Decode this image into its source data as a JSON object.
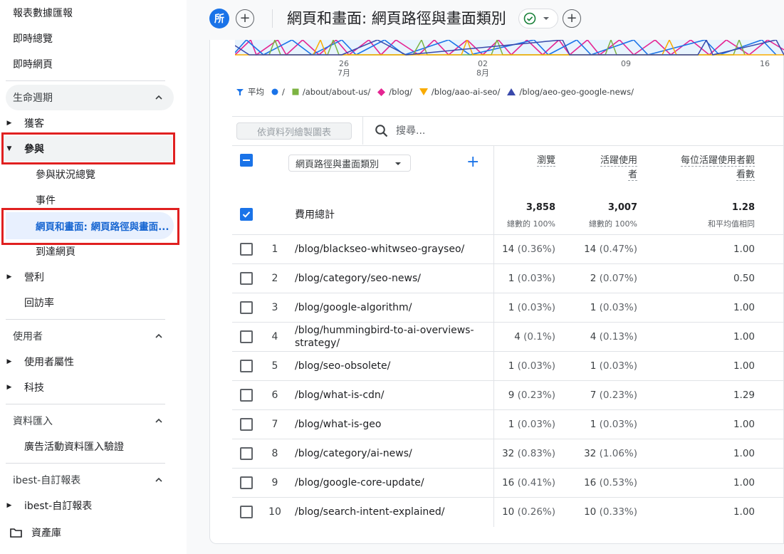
{
  "sidebar": {
    "items": [
      {
        "label": "報表數據匯報"
      },
      {
        "label": "即時總覽"
      },
      {
        "label": "即時網頁"
      }
    ],
    "sections": {
      "lifecycle": {
        "label": "生命週期"
      },
      "acquisition": {
        "label": "獲客"
      },
      "engagement": {
        "label": "參與"
      },
      "engagement_overview": {
        "label": "參與狀況總覽"
      },
      "events": {
        "label": "事件"
      },
      "pages_screens": {
        "label": "網頁和畫面: 網頁路徑與畫面..."
      },
      "landing_page": {
        "label": "到達網頁"
      },
      "monetization": {
        "label": "營利"
      },
      "retention": {
        "label": "回訪率"
      },
      "user": {
        "label": "使用者"
      },
      "user_attributes": {
        "label": "使用者屬性"
      },
      "tech": {
        "label": "科技"
      },
      "data_import": {
        "label": "資料匯入"
      },
      "campaign_import": {
        "label": "廣告活動資料匯入驗證"
      },
      "custom": {
        "label": "ibest-自訂報表"
      },
      "custom_item": {
        "label": "ibest-自訂報表"
      },
      "library": {
        "label": "資產庫"
      }
    }
  },
  "header": {
    "badge": "所",
    "add": "+",
    "title": "網頁和畫面: 網頁路徑與畫面類別"
  },
  "chart_axis": {
    "ticks": [
      {
        "day": "26",
        "month": "7月"
      },
      {
        "day": "02",
        "month": "8月"
      },
      {
        "day": "09",
        "month": ""
      },
      {
        "day": "16",
        "month": ""
      }
    ]
  },
  "legend": [
    {
      "label": "平均",
      "color": "#1a73e8",
      "marker": "avg"
    },
    {
      "label": "/",
      "color": "#1a73e8",
      "marker": "circle"
    },
    {
      "label": "/about/about-us/",
      "color": "#7cb342",
      "marker": "square"
    },
    {
      "label": "/blog/",
      "color": "#e52592",
      "marker": "diamond"
    },
    {
      "label": "/blog/aao-ai-seo/",
      "color": "#f9ab00",
      "marker": "triangle-down"
    },
    {
      "label": "/blog/aeo-geo-google-news/",
      "color": "#3949ab",
      "marker": "triangle-up"
    }
  ],
  "toolbar": {
    "plot_button": "依資料列繪製圖表",
    "search_placeholder": "搜尋..."
  },
  "table": {
    "dimension_label": "網頁路徑與畫面類別",
    "columns": {
      "views": "瀏覽",
      "active_users_1": "活躍使用",
      "active_users_2": "者",
      "views_per_user_1": "每位活躍使用者觀",
      "views_per_user_2": "看數"
    },
    "totals": {
      "label": "費用總計",
      "views": "3,858",
      "views_sub": "總數的 100%",
      "users": "3,007",
      "users_sub": "總數的 100%",
      "vpu": "1.28",
      "vpu_sub": "和平均值相同"
    },
    "rows": [
      {
        "idx": "1",
        "path": "/blog/blackseo-whitwseo-grayseo/",
        "views": "14",
        "views_pct": "(0.36%)",
        "users": "14",
        "users_pct": "(0.47%)",
        "vpu": "1.00"
      },
      {
        "idx": "2",
        "path": "/blog/category/seo-news/",
        "views": "1",
        "views_pct": "(0.03%)",
        "users": "2",
        "users_pct": "(0.07%)",
        "vpu": "0.50"
      },
      {
        "idx": "3",
        "path": "/blog/google-algorithm/",
        "views": "1",
        "views_pct": "(0.03%)",
        "users": "1",
        "users_pct": "(0.03%)",
        "vpu": "1.00"
      },
      {
        "idx": "4",
        "path": "/blog/hummingbird-to-ai-overviews-strategy/",
        "views": "4",
        "views_pct": "(0.1%)",
        "users": "4",
        "users_pct": "(0.13%)",
        "vpu": "1.00"
      },
      {
        "idx": "5",
        "path": "/blog/seo-obsolete/",
        "views": "1",
        "views_pct": "(0.03%)",
        "users": "1",
        "users_pct": "(0.03%)",
        "vpu": "1.00"
      },
      {
        "idx": "6",
        "path": "/blog/what-is-cdn/",
        "views": "9",
        "views_pct": "(0.23%)",
        "users": "7",
        "users_pct": "(0.23%)",
        "vpu": "1.29"
      },
      {
        "idx": "7",
        "path": "/blog/what-is-geo",
        "views": "1",
        "views_pct": "(0.03%)",
        "users": "1",
        "users_pct": "(0.03%)",
        "vpu": "1.00"
      },
      {
        "idx": "8",
        "path": "/blog/category/ai-news/",
        "views": "32",
        "views_pct": "(0.83%)",
        "users": "32",
        "users_pct": "(1.06%)",
        "vpu": "1.00"
      },
      {
        "idx": "9",
        "path": "/blog/google-core-update/",
        "views": "16",
        "views_pct": "(0.41%)",
        "users": "16",
        "users_pct": "(0.53%)",
        "vpu": "1.00"
      },
      {
        "idx": "10",
        "path": "/blog/search-intent-explained/",
        "views": "10",
        "views_pct": "(0.26%)",
        "users": "10",
        "users_pct": "(0.33%)",
        "vpu": "1.00"
      }
    ]
  },
  "colors": {
    "accent": "#1a73e8",
    "highlight": "#e02020",
    "active_bg": "#e8f0fe"
  }
}
